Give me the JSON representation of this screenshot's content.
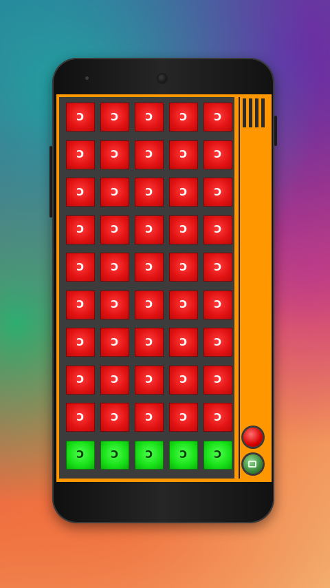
{
  "colors": {
    "panel_orange": "#ff9800",
    "pad_red": "#e11212",
    "pad_green": "#18e018",
    "grid_bg": "#3c3c3c"
  },
  "pads": {
    "label": "C",
    "rows": 10,
    "cols": 5,
    "row_colors": [
      "red",
      "red",
      "red",
      "red",
      "red",
      "red",
      "red",
      "red",
      "red",
      "green"
    ]
  },
  "side_panel": {
    "menu_icon": "menu-bars-icon",
    "record_icon": "record-icon",
    "play_icon": "play-icon"
  }
}
